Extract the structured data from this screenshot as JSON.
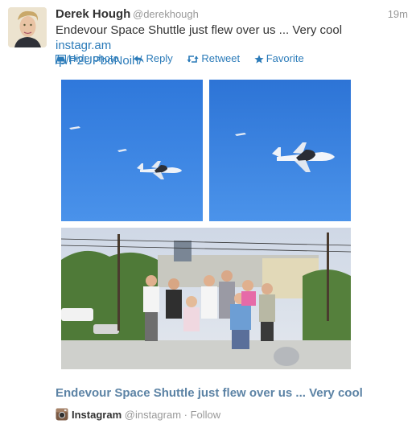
{
  "tweet": {
    "author_name": "Derek Hough",
    "author_handle": "@derekhough",
    "time": "19m",
    "text": "Endevour Space Shuttle just flew over us ... Very cool ",
    "link_line1": "instagr.am",
    "link_line2": "/p/P2UPboNoih/"
  },
  "actions": {
    "hide_photo": "Hide photo",
    "reply": "Reply",
    "retweet": "Retweet",
    "favorite": "Favorite"
  },
  "media": {
    "caption": "Endevour Space Shuttle just flew over us ... Very cool",
    "provider": "Instagram",
    "provider_handle": "@instagram",
    "separator": " · ",
    "follow": "Follow"
  },
  "colors": {
    "link": "#2b7bb9",
    "caption": "#5c83a5",
    "sky": "#3a82e0"
  }
}
